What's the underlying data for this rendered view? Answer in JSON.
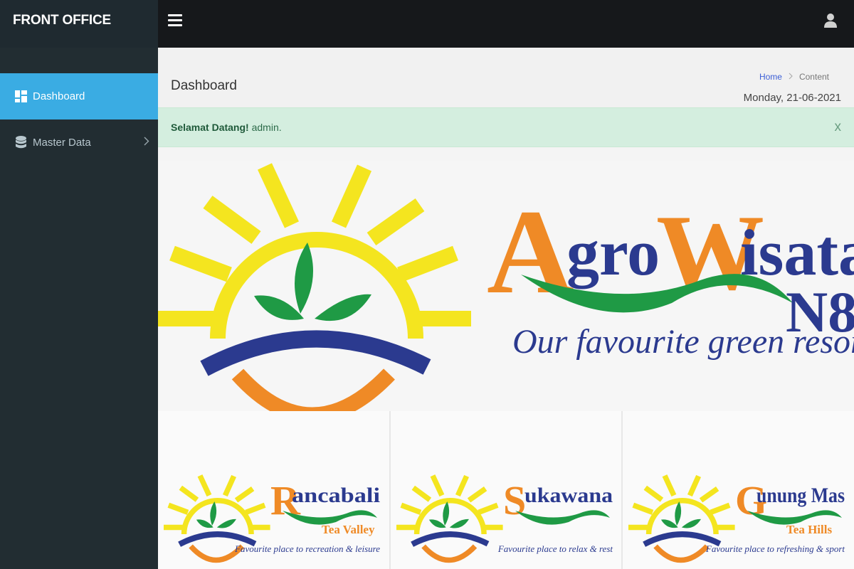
{
  "sidebar": {
    "brand": "FRONT OFFICE",
    "items": [
      {
        "label": "Dashboard",
        "icon": "dashboard-icon",
        "active": true
      },
      {
        "label": "Master Data",
        "icon": "database-icon",
        "active": false
      }
    ]
  },
  "header": {
    "menu_icon": "hamburger-icon",
    "user_icon": "user-icon"
  },
  "content": {
    "title": "Dashboard",
    "breadcrumb": [
      "Home",
      "Content"
    ],
    "date": "Monday, 21-06-2021"
  },
  "alert": {
    "strong": "Selamat Datang!",
    "text": " admin.",
    "close": "x"
  },
  "banner": {
    "word1_initial": "A",
    "word1_rest": "gro",
    "word2_initial": "W",
    "word2_rest": "isata",
    "suffix": "N8",
    "tagline": "Our favourite green resort",
    "cards": [
      {
        "initial": "R",
        "name": "ancabali",
        "subtitle": "Tea Valley",
        "caption": "Favourite place to recreation & leisure"
      },
      {
        "initial": "S",
        "name": "ukawana",
        "subtitle": "",
        "caption": "Favourite place to relax & rest"
      },
      {
        "initial": "G",
        "name": "unung Mas",
        "subtitle": "Tea Hills",
        "caption": "Favourite place to refreshing & sport"
      }
    ]
  },
  "colors": {
    "sidebar_bg": "#222d32",
    "active_item": "#3aace3",
    "topbar_bg": "#16181b",
    "alert_bg": "#d4eedf",
    "sun_yellow": "#f4e51f",
    "leaf_green": "#1f9a45",
    "arc_blue": "#2b3a8f",
    "arc_orange": "#ef8a26"
  }
}
